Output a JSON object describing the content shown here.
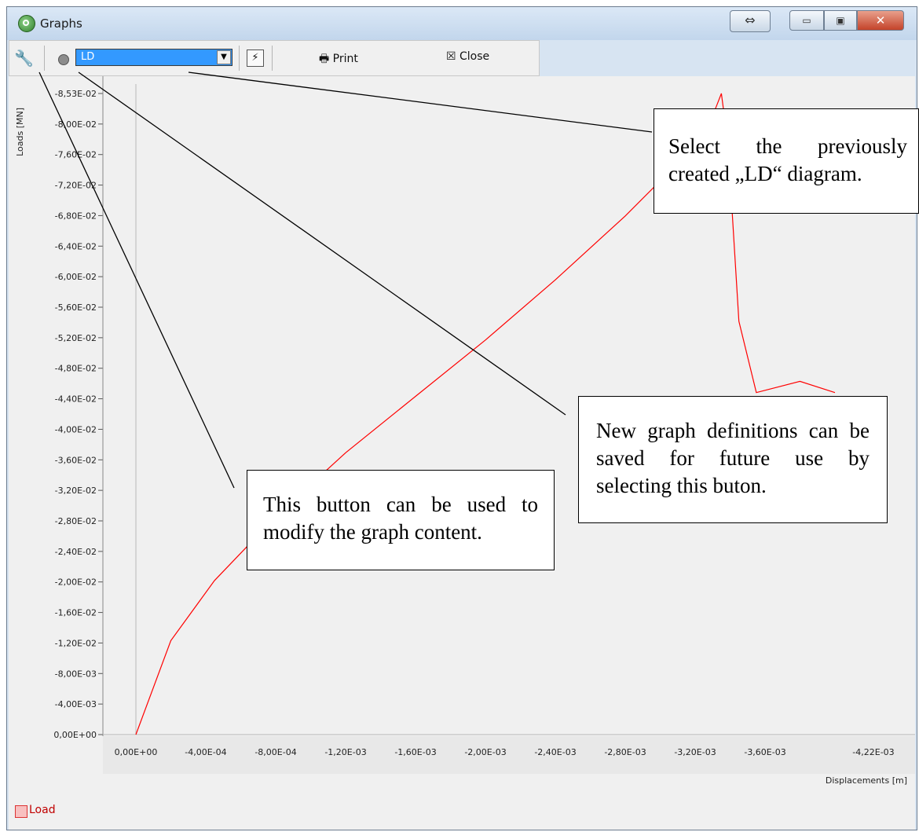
{
  "window": {
    "title": "Graphs",
    "controls": {
      "minimize": "▭",
      "maximize": "▣",
      "close": "✕",
      "snap": "⇔"
    }
  },
  "toolbar": {
    "graph_select_value": "LD",
    "print_label": "Print",
    "close_label": "Close",
    "icons": [
      "wrench-icon",
      "graph-dot-icon",
      "save-definition-icon",
      "printer-icon",
      "close-box-icon"
    ]
  },
  "chart_data": {
    "type": "line",
    "ylabel": "Loads [MN]",
    "xlabel": "Displacements [m]",
    "y_ticks": [
      "-8,53E-02",
      "-8,00E-02",
      "-7,60E-02",
      "-7,20E-02",
      "-6,80E-02",
      "-6,40E-02",
      "-6,00E-02",
      "-5,60E-02",
      "-5,20E-02",
      "-4,80E-02",
      "-4,40E-02",
      "-4,00E-02",
      "-3,60E-02",
      "-3,20E-02",
      "-2,80E-02",
      "-2,40E-02",
      "-2,00E-02",
      "-1,60E-02",
      "-1,20E-02",
      "-8,00E-03",
      "-4,00E-03",
      "0,00E+00"
    ],
    "x_ticks": [
      "0,00E+00",
      "-4,00E-04",
      "-8,00E-04",
      "-1,20E-03",
      "-1,60E-03",
      "-2,00E-03",
      "-2,40E-03",
      "-2,80E-03",
      "-3,20E-03",
      "-3,60E-03",
      "-4,22E-03"
    ],
    "xlim": [
      0,
      -0.00422
    ],
    "ylim": [
      0,
      -0.0853
    ],
    "series": [
      {
        "name": "Load",
        "color": "#ff0000",
        "x": [
          0,
          -0.0002,
          -0.00045,
          -0.0008,
          -0.0012,
          -0.0016,
          -0.002,
          -0.0024,
          -0.0028,
          -0.0031,
          -0.00325,
          -0.00332,
          -0.00335,
          -0.00338,
          -0.0034,
          -0.00345,
          -0.00355,
          -0.0038,
          -0.004
        ],
        "y": [
          0,
          -0.0125,
          -0.0205,
          -0.029,
          -0.0375,
          -0.045,
          -0.0525,
          -0.0605,
          -0.069,
          -0.076,
          -0.08,
          -0.0835,
          -0.0853,
          -0.08,
          -0.074,
          -0.055,
          -0.0455,
          -0.047,
          -0.0455
        ]
      }
    ],
    "grid": false,
    "legend": "bottom-left"
  },
  "annotations": {
    "select_diagram": "Select the previously created „LD“ diagram.",
    "save_definitions": "New graph definitions can be saved for future use by selecting this buton.",
    "modify_content": "This button can be used to modify the graph content."
  }
}
